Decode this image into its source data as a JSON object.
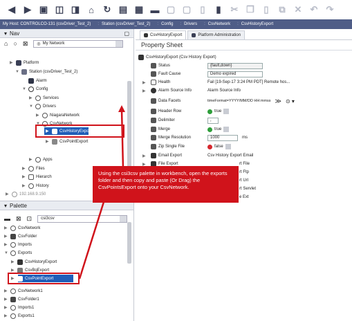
{
  "ord_path": [
    "My Host: CONTROLCO-131 (csvDriver_Test_2)",
    "Station (csvDriver_Test_2)",
    "Config",
    "Drivers",
    "CsvNetwork",
    "CsvHistoryExport"
  ],
  "nav": {
    "title": "Nav",
    "selector": "My Network",
    "tree": [
      {
        "label": "Platform"
      },
      {
        "label": "Station (csvDriver_Test_2)"
      },
      {
        "label": "Alarm"
      },
      {
        "label": "Config"
      },
      {
        "label": "Services"
      },
      {
        "label": "Drivers"
      },
      {
        "label": "NiagaraNetwork"
      },
      {
        "label": "CsvNetwork"
      },
      {
        "label": "CsvHistoryExport"
      },
      {
        "label": "CsvPointExport"
      },
      {
        "label": "Apps"
      },
      {
        "label": "Files"
      },
      {
        "label": "Hierarch"
      },
      {
        "label": "History"
      },
      {
        "label": "192.168.9.150"
      }
    ]
  },
  "palette": {
    "title": "Palette",
    "selector": "csi3csv",
    "tree": [
      {
        "label": "CsvNetwork"
      },
      {
        "label": "CsvFolder"
      },
      {
        "label": "Imports"
      },
      {
        "label": "Exports"
      },
      {
        "label": "CsvHistoryExport"
      },
      {
        "label": "CsvBqExport"
      },
      {
        "label": "CsvPointExport"
      },
      {
        "label": "CsvNetwork1"
      },
      {
        "label": "CsvFolder1"
      },
      {
        "label": "Imports1"
      },
      {
        "label": "Exports1"
      }
    ]
  },
  "tabs": [
    {
      "label": "CsvHistoryExport"
    },
    {
      "label": "Platform Administration"
    }
  ],
  "property_sheet": {
    "title": "Property Sheet",
    "root": "CsvHistoryExport  (Csv History Export)",
    "rows": [
      {
        "name": "Status",
        "value": "{fault,down}"
      },
      {
        "name": "Fault Cause",
        "value": "Demo expired"
      },
      {
        "name": "Health",
        "value": "Fail [19-Sep-17 3:24 PM PDT] Remote hos..."
      },
      {
        "name": "Alarm Source Info",
        "value": "Alarm Source Info"
      },
      {
        "name": "Data Facets",
        "value": "timeFormat=YYYY/MM/DD HH:mmss"
      },
      {
        "name": "Header Row",
        "value": "true"
      },
      {
        "name": "Delimiter",
        "value": ","
      },
      {
        "name": "Merge",
        "value": "true"
      },
      {
        "name": "Merge Resolution",
        "value": "1000",
        "unit": "ms"
      },
      {
        "name": "Zip Single File",
        "value": "false"
      },
      {
        "name": "Email Export",
        "value": "Csv History Export Email"
      },
      {
        "name": "File Export",
        "value": "rt File"
      },
      {
        "name": "Ftp Export",
        "value": "rt Ftp"
      },
      {
        "name": "Url Export",
        "value": "rt Url"
      },
      {
        "name": "Servlet Export",
        "value": "rt Servlet"
      },
      {
        "name": "Ext Export",
        "value": "e Ext"
      }
    ]
  },
  "callout": "Using the csi3csv palette in workbench, open the exports folder and then copy and paste (Or Drag) the CsvPointsExport onto your CsvNetwork.",
  "colors": {
    "callout": "#d0131b",
    "selection": "#1f5db8",
    "ordbar": "#4f5d87"
  }
}
